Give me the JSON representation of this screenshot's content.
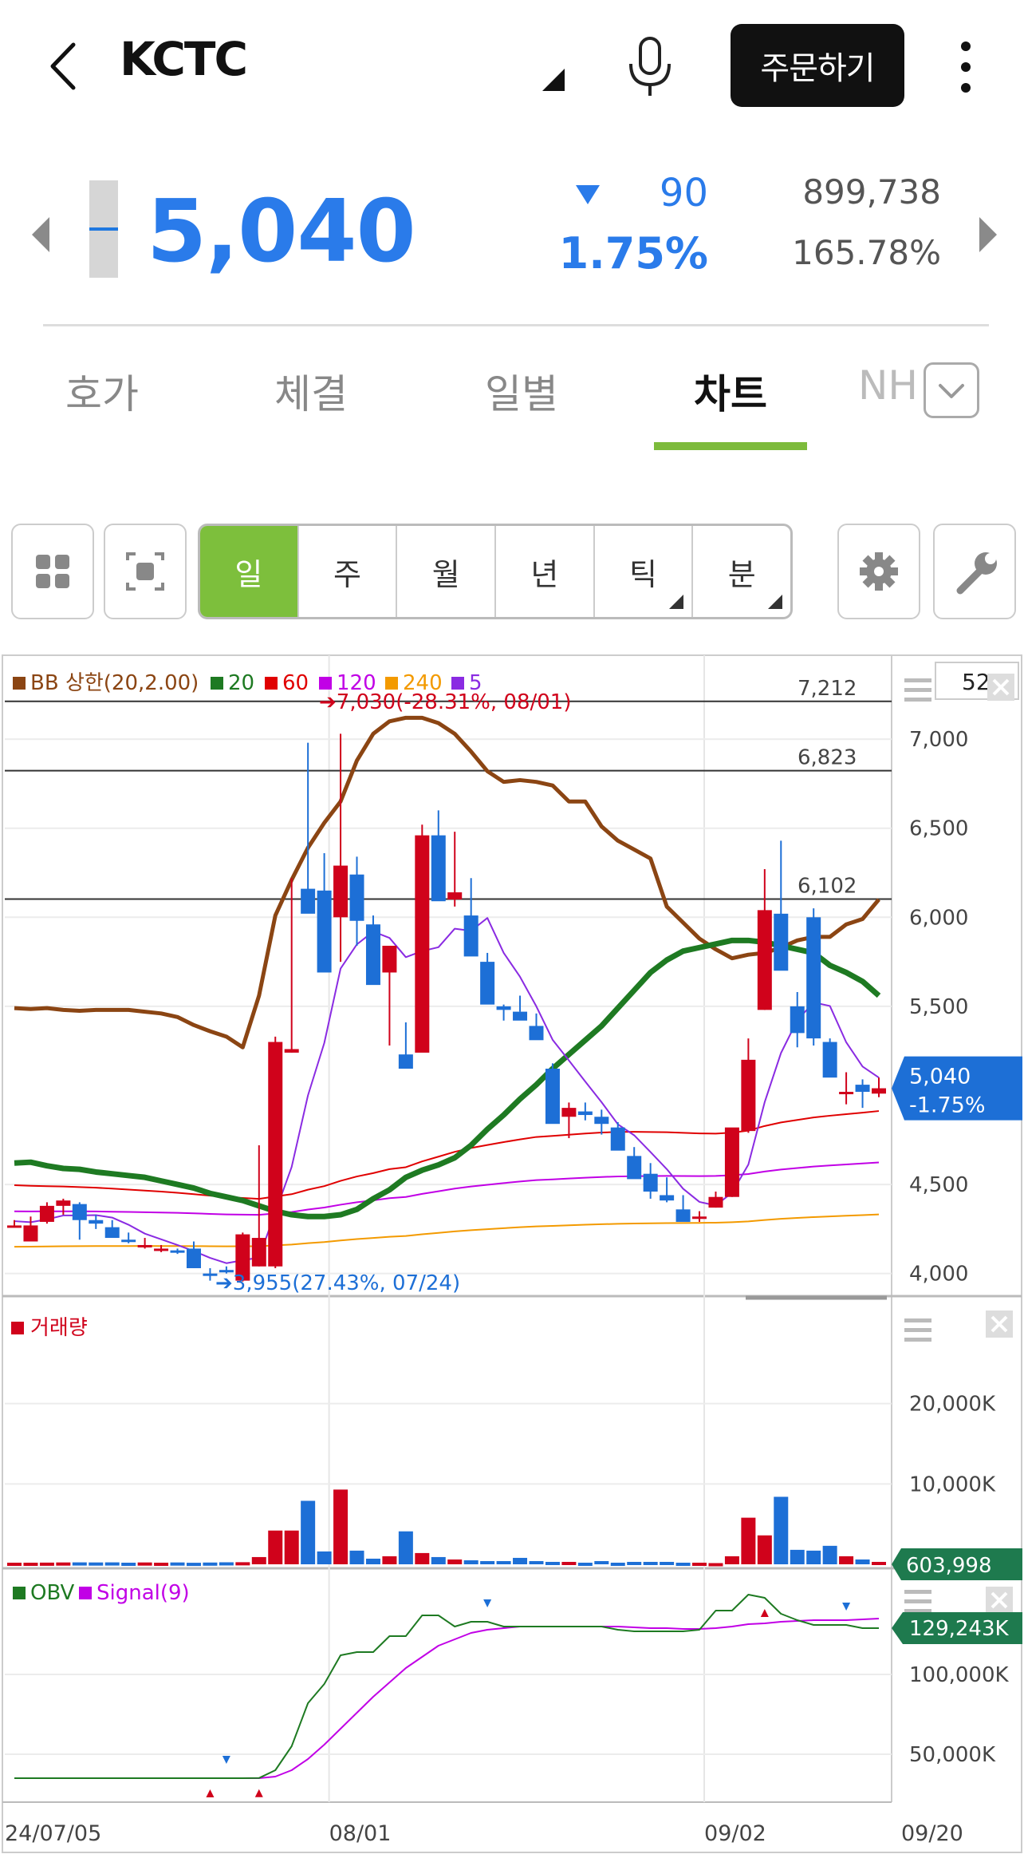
{
  "header": {
    "title": "KCTC",
    "order_label": "주문하기"
  },
  "quote": {
    "price": "5,040",
    "change": "90",
    "change_pct": "1.75%",
    "volume": "899,738",
    "volume_pct": "165.78%"
  },
  "tabs": [
    {
      "label": "호가",
      "active": false
    },
    {
      "label": "체결",
      "active": false
    },
    {
      "label": "일별",
      "active": false
    },
    {
      "label": "차트",
      "active": true
    },
    {
      "label": "NH",
      "active": false
    }
  ],
  "periods": [
    {
      "label": "일",
      "active": true,
      "has_menu": false
    },
    {
      "label": "주",
      "active": false,
      "has_menu": false
    },
    {
      "label": "월",
      "active": false,
      "has_menu": false
    },
    {
      "label": "년",
      "active": false,
      "has_menu": false
    },
    {
      "label": "틱",
      "active": false,
      "has_menu": true
    },
    {
      "label": "분",
      "active": false,
      "has_menu": true
    }
  ],
  "colors": {
    "up": "#d0021b",
    "down": "#1d6fd6",
    "accent": "#7dbf3c",
    "bb_upper": "#8b4513",
    "ma20": "#1e7a22",
    "ma60": "#e00000",
    "ma120": "#c100e6",
    "ma240": "#f39a00",
    "ma5": "#8a2be2"
  },
  "icons": {
    "back": "chevron-left-icon",
    "mic": "mic-icon",
    "more": "more-vertical-icon",
    "layout": "grid-icon",
    "capture": "capture-icon",
    "settings": "gear-icon",
    "tools": "wrench-icon"
  },
  "chart_data": [
    {
      "type": "candlestick",
      "legend": [
        {
          "name": "BB 상한(20,2.00)",
          "color": "#8b4513"
        },
        {
          "name": "20",
          "color": "#1e7a22"
        },
        {
          "name": "60",
          "color": "#e00000"
        },
        {
          "name": "120",
          "color": "#c100e6"
        },
        {
          "name": "240",
          "color": "#f39a00"
        },
        {
          "name": "5",
          "color": "#8a2be2"
        }
      ],
      "count_box": "52",
      "x_ticks": [
        "24/07/05",
        "08/01",
        "09/02",
        "09/20"
      ],
      "y_ticks": [
        "7,000",
        "6,500",
        "6,000",
        "5,500",
        "4,500",
        "4,000"
      ],
      "ylim": [
        3900,
        7350
      ],
      "hlines": [
        {
          "value": 7212,
          "label": "7,212"
        },
        {
          "value": 6823,
          "label": "6,823"
        },
        {
          "value": 6102,
          "label": "6,102"
        }
      ],
      "max_annotation": "7,030(-28.31%, 08/01)",
      "min_annotation": "3,955(27.43%, 07/24)",
      "current_label": "5,040",
      "current_change": "-1.75%",
      "candles": [
        [
          4270,
          4300,
          4260,
          4270
        ],
        [
          4180,
          4320,
          4180,
          4270
        ],
        [
          4290,
          4400,
          4280,
          4380
        ],
        [
          4380,
          4420,
          4330,
          4410
        ],
        [
          4390,
          4400,
          4190,
          4300
        ],
        [
          4300,
          4330,
          4250,
          4280
        ],
        [
          4260,
          4300,
          4230,
          4200
        ],
        [
          4190,
          4230,
          4170,
          4180
        ],
        [
          4160,
          4200,
          4140,
          4160
        ],
        [
          4140,
          4160,
          4120,
          4140
        ],
        [
          4130,
          4140,
          4110,
          4120
        ],
        [
          4140,
          4180,
          4030,
          4030
        ],
        [
          4000,
          4030,
          3960,
          3990
        ],
        [
          4020,
          4040,
          4000,
          4010
        ],
        [
          3960,
          4230,
          3955,
          4220
        ],
        [
          4040,
          4720,
          4040,
          4200
        ],
        [
          4040,
          5330,
          4030,
          5300
        ],
        [
          5240,
          6220,
          5240,
          5260
        ],
        [
          6160,
          6980,
          6140,
          6020
        ],
        [
          6150,
          6360,
          5720,
          5690
        ],
        [
          6000,
          7030,
          5750,
          6290
        ],
        [
          6240,
          6340,
          5840,
          5980
        ],
        [
          5960,
          6010,
          5770,
          5620
        ],
        [
          5690,
          5840,
          5280,
          5840
        ],
        [
          5230,
          5410,
          5190,
          5150
        ],
        [
          5240,
          6520,
          5260,
          6460
        ],
        [
          6460,
          6600,
          6210,
          6090
        ],
        [
          6100,
          6480,
          6060,
          6140
        ],
        [
          6010,
          6220,
          5900,
          5780
        ],
        [
          5750,
          5800,
          5530,
          5510
        ],
        [
          5500,
          5510,
          5420,
          5480
        ],
        [
          5470,
          5560,
          5470,
          5420
        ],
        [
          5390,
          5460,
          5360,
          5310
        ],
        [
          5150,
          5180,
          4910,
          4840
        ],
        [
          4880,
          4960,
          4760,
          4930
        ],
        [
          4910,
          4960,
          4860,
          4890
        ],
        [
          4880,
          4920,
          4780,
          4840
        ],
        [
          4820,
          4850,
          4710,
          4690
        ],
        [
          4660,
          4710,
          4550,
          4530
        ],
        [
          4560,
          4620,
          4420,
          4460
        ],
        [
          4440,
          4540,
          4400,
          4410
        ],
        [
          4360,
          4440,
          4320,
          4290
        ],
        [
          4320,
          4350,
          4290,
          4320
        ],
        [
          4370,
          4460,
          4370,
          4430
        ],
        [
          4430,
          4750,
          4430,
          4820
        ],
        [
          4800,
          5320,
          4790,
          5200
        ],
        [
          5480,
          6270,
          5480,
          6040
        ],
        [
          6020,
          6430,
          5880,
          5700
        ],
        [
          5500,
          5580,
          5270,
          5350
        ],
        [
          6000,
          6050,
          5280,
          5320
        ],
        [
          5300,
          5320,
          5150,
          5100
        ],
        [
          5010,
          5130,
          4950,
          5020
        ],
        [
          5060,
          5090,
          4930,
          5020
        ],
        [
          5010,
          5100,
          4990,
          5040
        ]
      ],
      "bb_upper": [
        5490,
        5485,
        5490,
        5480,
        5475,
        5480,
        5480,
        5480,
        5470,
        5460,
        5440,
        5395,
        5360,
        5330,
        5270,
        5560,
        6010,
        6210,
        6390,
        6530,
        6650,
        6880,
        7030,
        7100,
        7120,
        7120,
        7090,
        7030,
        6930,
        6820,
        6760,
        6770,
        6760,
        6740,
        6650,
        6650,
        6510,
        6430,
        6380,
        6330,
        6060,
        5970,
        5880,
        5820,
        5770,
        5790,
        5800,
        5830,
        5870,
        5890,
        5890,
        5960,
        5990,
        6100
      ],
      "ma20": [
        4620,
        4625,
        4605,
        4590,
        4585,
        4570,
        4560,
        4550,
        4540,
        4520,
        4500,
        4480,
        4450,
        4430,
        4410,
        4380,
        4350,
        4330,
        4320,
        4320,
        4330,
        4360,
        4420,
        4470,
        4540,
        4580,
        4610,
        4650,
        4720,
        4810,
        4890,
        4980,
        5060,
        5150,
        5230,
        5310,
        5390,
        5490,
        5590,
        5690,
        5760,
        5810,
        5830,
        5850,
        5870,
        5870,
        5860,
        5840,
        5820,
        5800,
        5730,
        5690,
        5640,
        5560
      ],
      "volume": {
        "type": "bar",
        "label": "거래량",
        "y_ticks": [
          "20,000K",
          "10,000K"
        ],
        "ylim": [
          0,
          30000
        ],
        "current_label": "603,998",
        "values": [
          200,
          200,
          210,
          230,
          240,
          230,
          240,
          200,
          230,
          200,
          230,
          190,
          220,
          250,
          260,
          900,
          4200,
          4200,
          7900,
          1600,
          9300,
          1700,
          700,
          1000,
          4100,
          1400,
          900,
          600,
          500,
          400,
          400,
          800,
          400,
          300,
          300,
          200,
          400,
          200,
          300,
          300,
          300,
          200,
          200,
          150,
          1000,
          5800,
          3600,
          8400,
          1800,
          1700,
          2300,
          1000,
          600,
          300
        ]
      },
      "obv": {
        "type": "line",
        "legend": [
          {
            "name": "OBV",
            "color": "#1e7a22"
          },
          {
            "name": "Signal(9)",
            "color": "#c100e6"
          }
        ],
        "y_ticks": [
          "100,000K",
          "50,000K"
        ],
        "current_label": "129,243K",
        "obv": [
          35000,
          35000,
          35000,
          35000,
          35000,
          35000,
          35000,
          35000,
          35000,
          35000,
          35000,
          35000,
          35000,
          35000,
          35000,
          35100,
          40000,
          55000,
          82000,
          94000,
          112000,
          114000,
          114000,
          124000,
          124000,
          137000,
          137000,
          130000,
          133000,
          133000,
          130000,
          130000,
          130000,
          130000,
          130000,
          130000,
          130000,
          128000,
          127000,
          127000,
          127000,
          127000,
          128000,
          140000,
          140000,
          150000,
          148000,
          138000,
          134000,
          131000,
          131000,
          131000,
          129000,
          129000
        ],
        "signal": [
          35000,
          35000,
          35000,
          35000,
          35000,
          35000,
          35000,
          35000,
          35000,
          35000,
          35000,
          35000,
          35000,
          35000,
          35000,
          35000,
          36000,
          40000,
          47000,
          56000,
          66000,
          76000,
          86000,
          95000,
          104000,
          111000,
          118000,
          122000,
          126000,
          128000,
          129000,
          130000,
          130000,
          130000,
          130000,
          130000,
          130000,
          130000,
          129500,
          129000,
          129000,
          128500,
          128500,
          129000,
          130000,
          131500,
          132000,
          133000,
          133500,
          134000,
          134000,
          134000,
          134500,
          135000
        ]
      }
    }
  ]
}
